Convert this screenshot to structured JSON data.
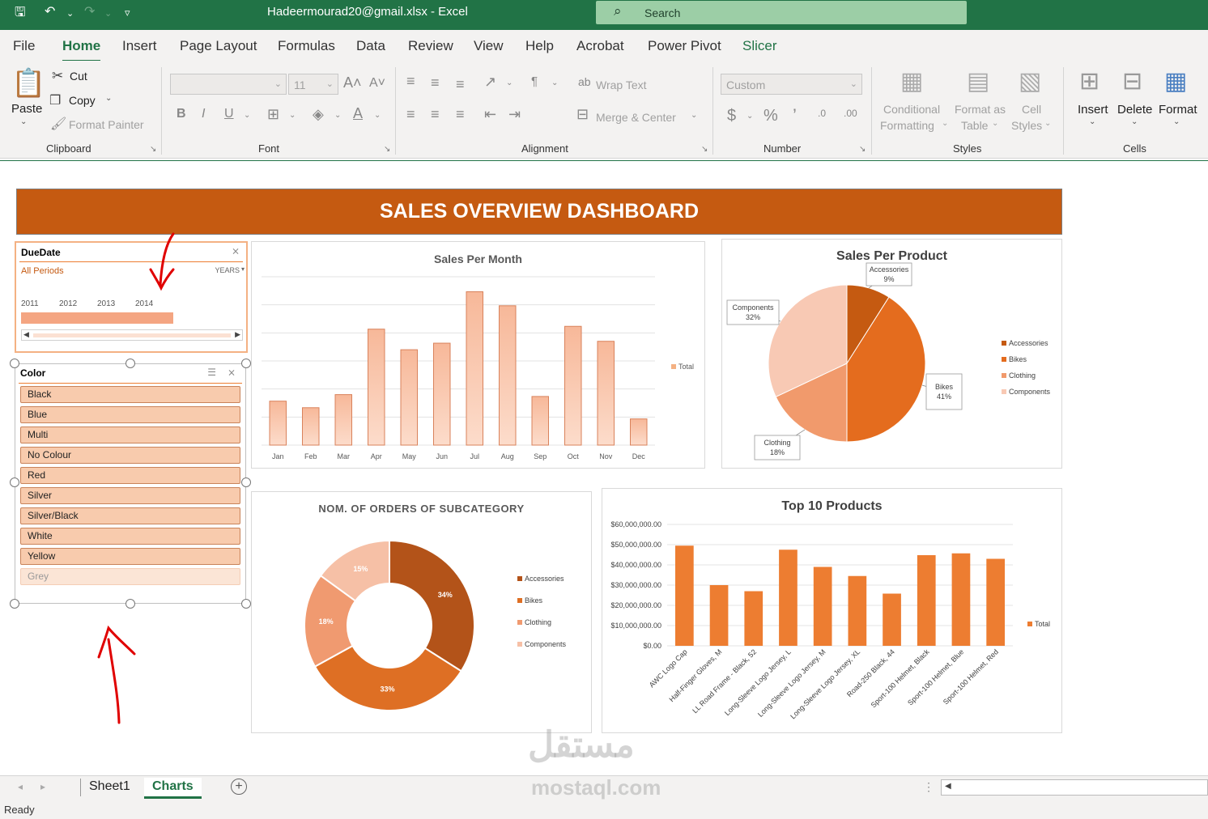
{
  "window": {
    "filename": "Hadeermourad20@gmail.xlsx  -  Excel",
    "search_placeholder": "Search"
  },
  "menu": [
    "File",
    "Home",
    "Insert",
    "Page Layout",
    "Formulas",
    "Data",
    "Review",
    "View",
    "Help",
    "Acrobat",
    "Power Pivot",
    "Slicer"
  ],
  "ribbon": {
    "clipboard": {
      "paste": "Paste",
      "cut": "Cut",
      "copy": "Copy",
      "format_painter": "Format Painter",
      "label": "Clipboard"
    },
    "font": {
      "size": "11",
      "label": "Font"
    },
    "alignment": {
      "wrap_text": "Wrap Text",
      "merge_center": "Merge & Center",
      "label": "Alignment"
    },
    "number": {
      "format": "Custom",
      "label": "Number"
    },
    "styles": {
      "conditional": "Conditional",
      "formatting": "Formatting",
      "format_as": "Format as",
      "table": "Table",
      "cell": "Cell",
      "cell_styles": "Styles",
      "label": "Styles"
    },
    "cells": {
      "insert": "Insert",
      "delete": "Delete",
      "format": "Format",
      "label": "Cells"
    }
  },
  "dashboard": {
    "title": "SALES OVERVIEW DASHBOARD"
  },
  "slicer_duedate": {
    "header": "DueDate",
    "period": "All Periods",
    "level": "YEARS",
    "years": [
      "2011",
      "2012",
      "2013",
      "2014"
    ]
  },
  "slicer_color": {
    "header": "Color",
    "items": [
      "Black",
      "Blue",
      "Multi",
      "No Colour",
      "Red",
      "Silver",
      "Silver/Black",
      "White",
      "Yellow",
      "Grey"
    ]
  },
  "colors": {
    "excel_green": "#217346",
    "banner": "#c55a11",
    "bar_light": "#f4b183",
    "bar_orange": "#ed7d31",
    "pie_accessories": "#c55a11",
    "pie_bikes": "#e46c1e",
    "pie_clothing": "#f19a6c",
    "pie_components": "#f8c9b4"
  },
  "chart_data": [
    {
      "type": "bar",
      "title": "Sales Per Month",
      "categories": [
        "Jan",
        "Feb",
        "Mar",
        "Apr",
        "May",
        "Jun",
        "Jul",
        "Aug",
        "Sep",
        "Oct",
        "Nov",
        "Dec"
      ],
      "series": [
        {
          "name": "Total",
          "values": [
            4.7,
            4.0,
            5.4,
            12.4,
            10.2,
            10.9,
            16.4,
            14.9,
            5.2,
            12.7,
            11.1,
            2.8
          ]
        }
      ],
      "ylim": [
        0,
        18
      ],
      "grid": true,
      "legend": "right"
    },
    {
      "type": "pie",
      "title": "Sales Per Product",
      "categories": [
        "Accessories",
        "Bikes",
        "Clothing",
        "Components"
      ],
      "values": [
        9,
        41,
        18,
        32
      ],
      "data_labels": [
        [
          "Accessories",
          "9%"
        ],
        [
          "Bikes",
          "41%"
        ],
        [
          "Clothing",
          "18%"
        ],
        [
          "Components",
          "32%"
        ]
      ],
      "legend": "right"
    },
    {
      "type": "pie",
      "title": "NOM. OF ORDERS OF SUBCATEGORY",
      "categories": [
        "Accessories",
        "Bikes",
        "Clothing",
        "Components"
      ],
      "values": [
        34,
        33,
        18,
        15
      ],
      "data_labels": [
        "34%",
        "33%",
        "18%",
        "15%"
      ],
      "legend": "right"
    },
    {
      "type": "bar",
      "title": "Top 10 Products",
      "categories": [
        "AWC Logo Cap",
        "Half-Finger Gloves, M",
        "LL Road Frame - Black, 52",
        "Long-Sleeve Logo Jersey, L",
        "Long-Sleeve Logo Jersey, M",
        "Long-Sleeve Logo Jersey, XL",
        "Road-250 Black, 44",
        "Sport-100 Helmet, Black",
        "Sport-100 Helmet, Blue",
        "Sport-100 Helmet, Red"
      ],
      "series": [
        {
          "name": "Total",
          "values": [
            49500000,
            30000000,
            27000000,
            47500000,
            39000000,
            34500000,
            25800000,
            44800000,
            45700000,
            43000000
          ]
        }
      ],
      "ytick_labels": [
        "$0.00",
        "$10,000,000.00",
        "$20,000,000.00",
        "$30,000,000.00",
        "$40,000,000.00",
        "$50,000,000.00",
        "$60,000,000.00"
      ],
      "ylim": [
        0,
        60000000
      ],
      "grid": true,
      "legend": "right"
    }
  ],
  "sheet_tabs": [
    "Sheet1",
    "Charts"
  ],
  "status": "Ready",
  "watermark": {
    "arabic": "مستقل",
    "latin": "mostaql.com"
  }
}
